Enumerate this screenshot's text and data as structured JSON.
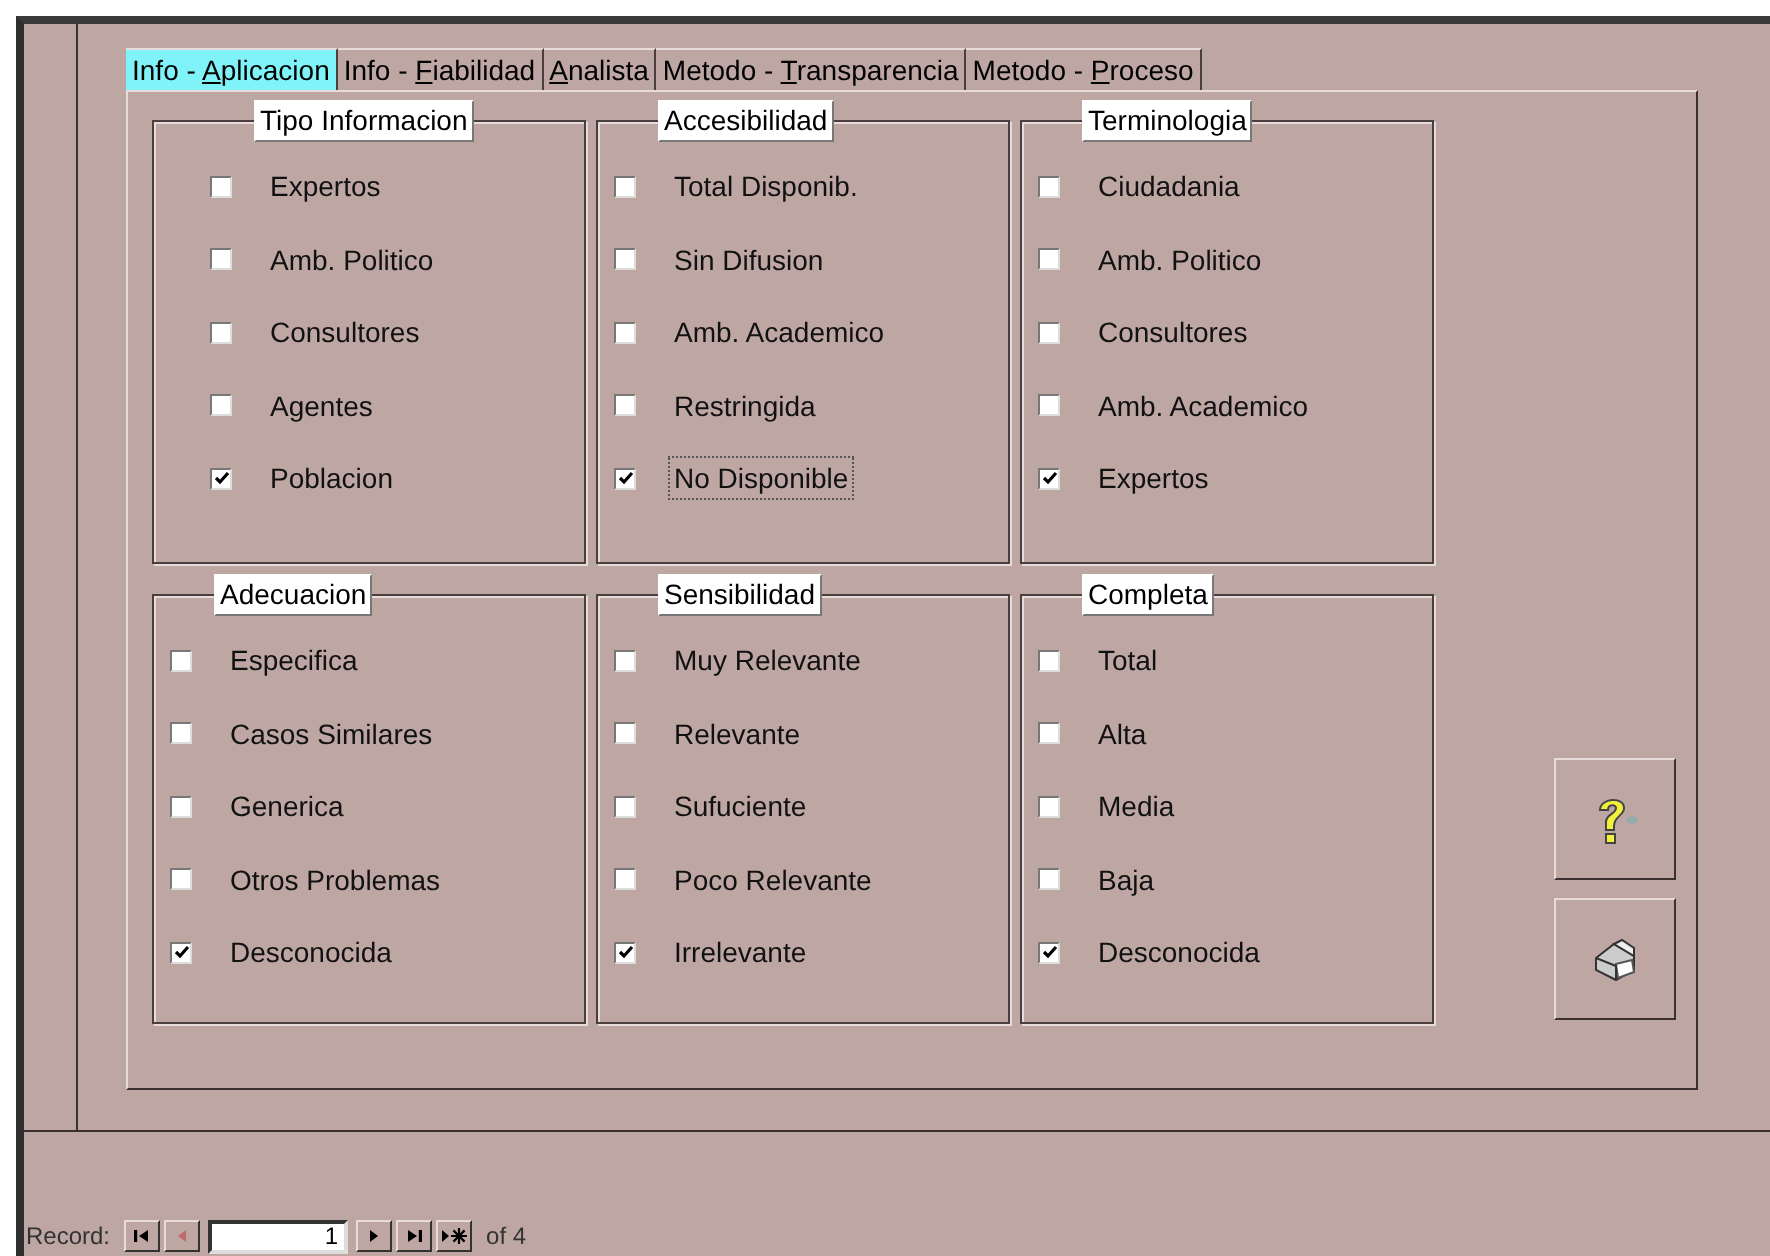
{
  "tabs": [
    {
      "before": "Info - ",
      "key": "A",
      "after": "plicacion",
      "selected": true
    },
    {
      "before": "Info - ",
      "key": "F",
      "after": "iabilidad",
      "selected": false
    },
    {
      "key": "A",
      "after": "nalista",
      "selected": false
    },
    {
      "before": "Metodo - ",
      "key": "T",
      "after": "ransparencia",
      "selected": false
    },
    {
      "before": "Metodo - ",
      "key": "P",
      "after": "roceso",
      "selected": false
    }
  ],
  "groups": [
    {
      "title": "Tipo Informacion",
      "options": [
        {
          "label": "Expertos",
          "checked": false,
          "focused": false
        },
        {
          "label": "Amb. Politico",
          "checked": false,
          "focused": false
        },
        {
          "label": "Consultores",
          "checked": false,
          "focused": false
        },
        {
          "label": "Agentes",
          "checked": false,
          "focused": false
        },
        {
          "label": "Poblacion",
          "checked": true,
          "focused": false
        }
      ]
    },
    {
      "title": "Accesibilidad",
      "options": [
        {
          "label": "Total Disponib.",
          "checked": false,
          "focused": false
        },
        {
          "label": "Sin Difusion",
          "checked": false,
          "focused": false
        },
        {
          "label": "Amb. Academico",
          "checked": false,
          "focused": false
        },
        {
          "label": "Restringida",
          "checked": false,
          "focused": false
        },
        {
          "label": "No Disponible",
          "checked": true,
          "focused": true
        }
      ]
    },
    {
      "title": "Terminologia",
      "options": [
        {
          "label": "Ciudadania",
          "checked": false,
          "focused": false
        },
        {
          "label": "Amb. Politico",
          "checked": false,
          "focused": false
        },
        {
          "label": "Consultores",
          "checked": false,
          "focused": false
        },
        {
          "label": "Amb. Academico",
          "checked": false,
          "focused": false
        },
        {
          "label": "Expertos",
          "checked": true,
          "focused": false
        }
      ]
    },
    {
      "title": "Adecuacion",
      "options": [
        {
          "label": "Especifica",
          "checked": false,
          "focused": false
        },
        {
          "label": "Casos Similares",
          "checked": false,
          "focused": false
        },
        {
          "label": "Generica",
          "checked": false,
          "focused": false
        },
        {
          "label": "Otros Problemas",
          "checked": false,
          "focused": false
        },
        {
          "label": "Desconocida",
          "checked": true,
          "focused": false
        }
      ]
    },
    {
      "title": "Sensibilidad",
      "options": [
        {
          "label": "Muy Relevante",
          "checked": false,
          "focused": false
        },
        {
          "label": "Relevante",
          "checked": false,
          "focused": false
        },
        {
          "label": "Sufuciente",
          "checked": false,
          "focused": false
        },
        {
          "label": "Poco Relevante",
          "checked": false,
          "focused": false
        },
        {
          "label": "Irrelevante",
          "checked": true,
          "focused": false
        }
      ]
    },
    {
      "title": "Completa",
      "options": [
        {
          "label": "Total",
          "checked": false,
          "focused": false
        },
        {
          "label": "Alta",
          "checked": false,
          "focused": false
        },
        {
          "label": "Media",
          "checked": false,
          "focused": false
        },
        {
          "label": "Baja",
          "checked": false,
          "focused": false
        },
        {
          "label": "Desconocida",
          "checked": true,
          "focused": false
        }
      ]
    }
  ],
  "side_buttons": [
    {
      "kind": "help"
    },
    {
      "kind": "print"
    }
  ],
  "record_nav": {
    "label": "Record:",
    "current": "1",
    "of": "of 4",
    "buttons": [
      {
        "kind": "first",
        "disabled": false
      },
      {
        "kind": "prev",
        "disabled": true
      },
      {
        "kind": "next",
        "disabled": false
      },
      {
        "kind": "last",
        "disabled": false
      },
      {
        "kind": "new",
        "disabled": false
      }
    ]
  }
}
